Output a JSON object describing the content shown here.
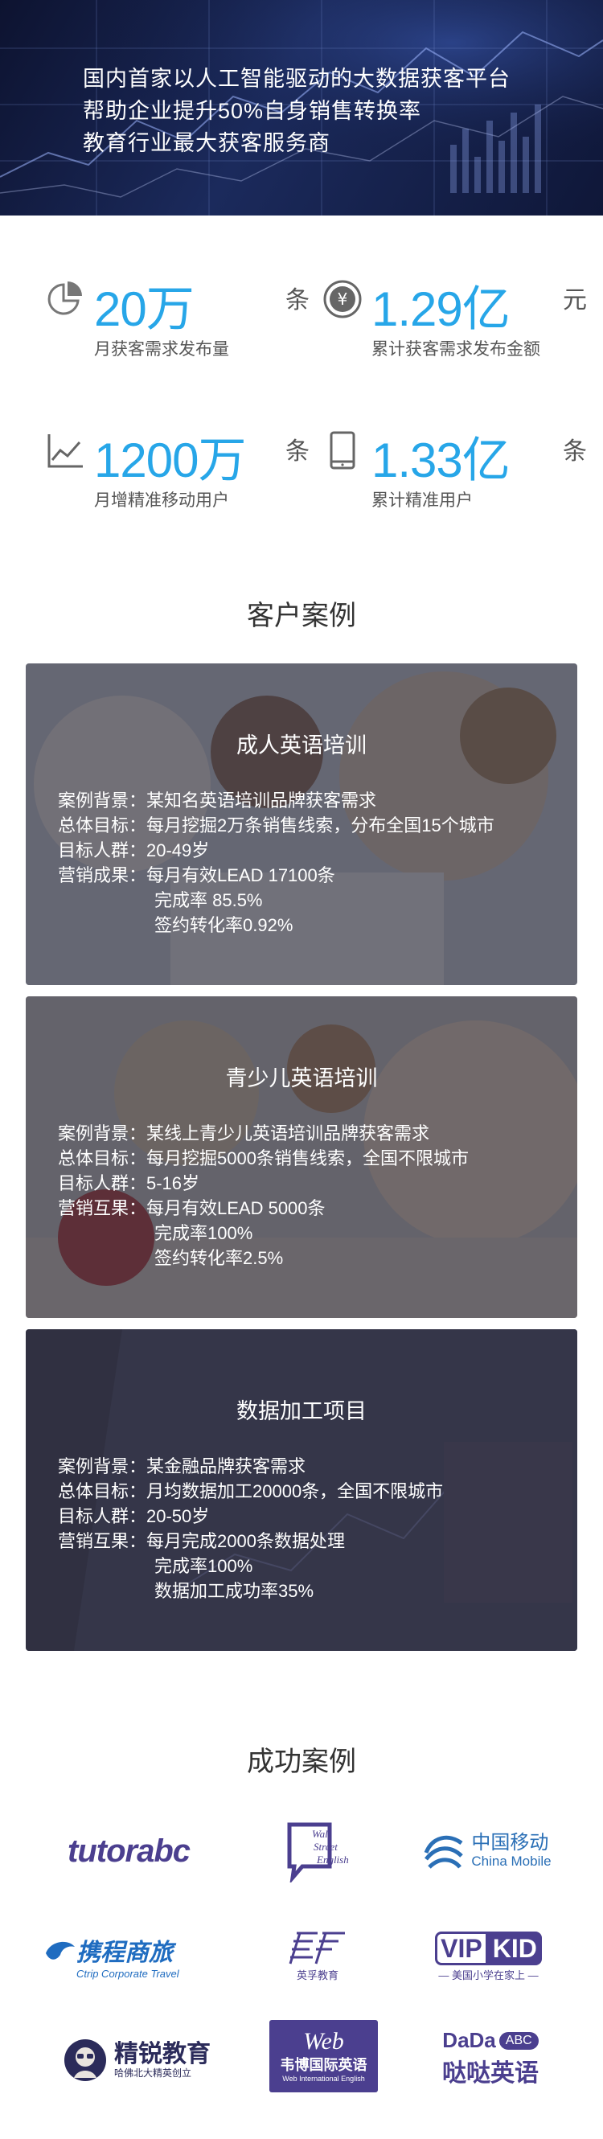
{
  "hero": {
    "lines": [
      "国内首家以人工智能驱动的大数据获客平台",
      "帮助企业提升50%自身销售转换率",
      "教育行业最大获客服务商"
    ]
  },
  "stats": [
    {
      "icon": "pie-chart-icon",
      "value": "20万",
      "unit": "条",
      "label": "月获客需求发布量"
    },
    {
      "icon": "yen-coin-icon",
      "value": "1.29亿",
      "unit": "元",
      "label": "累计获客需求发布金额"
    },
    {
      "icon": "line-chart-icon",
      "value": "1200万",
      "unit": "条",
      "label": "月增精准移动用户"
    },
    {
      "icon": "tablet-icon",
      "value": "1.33亿",
      "unit": "条",
      "label": "累计精准用户"
    }
  ],
  "cases_title": "客户案例",
  "cases": [
    {
      "title": "成人英语培训",
      "lines": [
        "案例背景：某知名英语培训品牌获客需求",
        "总体目标：每月挖掘2万条销售线索，分布全国15个城市",
        "目标人群：20-49岁",
        "营销成果：每月有效LEAD 17100条"
      ],
      "extra": [
        "完成率 85.5%",
        "签约转化率0.92%"
      ]
    },
    {
      "title": "青少儿英语培训",
      "lines": [
        "案例背景：某线上青少儿英语培训品牌获客需求",
        "总体目标：每月挖掘5000条销售线索，全国不限城市",
        "目标人群：5-16岁",
        "营销互果：每月有效LEAD 5000条"
      ],
      "extra": [
        "完成率100%",
        "签约转化率2.5%"
      ]
    },
    {
      "title": "数据加工项目",
      "lines": [
        "案例背景：某金融品牌获客需求",
        "总体目标：月均数据加工20000条，全国不限城市",
        "目标人群：20-50岁",
        "营销互果：每月完成2000条数据处理"
      ],
      "extra": [
        "完成率100%",
        "数据加工成功率35%"
      ]
    }
  ],
  "success_title": "成功案例",
  "logos": {
    "tutorabc": "tutorabc",
    "wallstreet": [
      "Wall",
      "Street",
      "English"
    ],
    "cmcc_cn": "中国移动",
    "cmcc_en": "China Mobile",
    "ctrip_cn": "携程商旅",
    "ctrip_en": "Ctrip Corporate Travel",
    "ef_sub": "英孚教育",
    "vipkid_sub": "— 美国小学在家上 —",
    "jingrui_cn": "精锐教育",
    "jingrui_sub": "哈佛北大精英创立",
    "web_cn": "韦博国际英语",
    "web_en": "Web International English",
    "dada_top": "DaDa",
    "dada_abc": "ABC",
    "dada_cn": "哒哒英语",
    "colors": {
      "stat_blue": "#27a6e8",
      "logo_purple": "#4b3f8f",
      "cmcc_blue": "#2a6fb6",
      "ctrip_blue": "#1f6cc0"
    }
  }
}
